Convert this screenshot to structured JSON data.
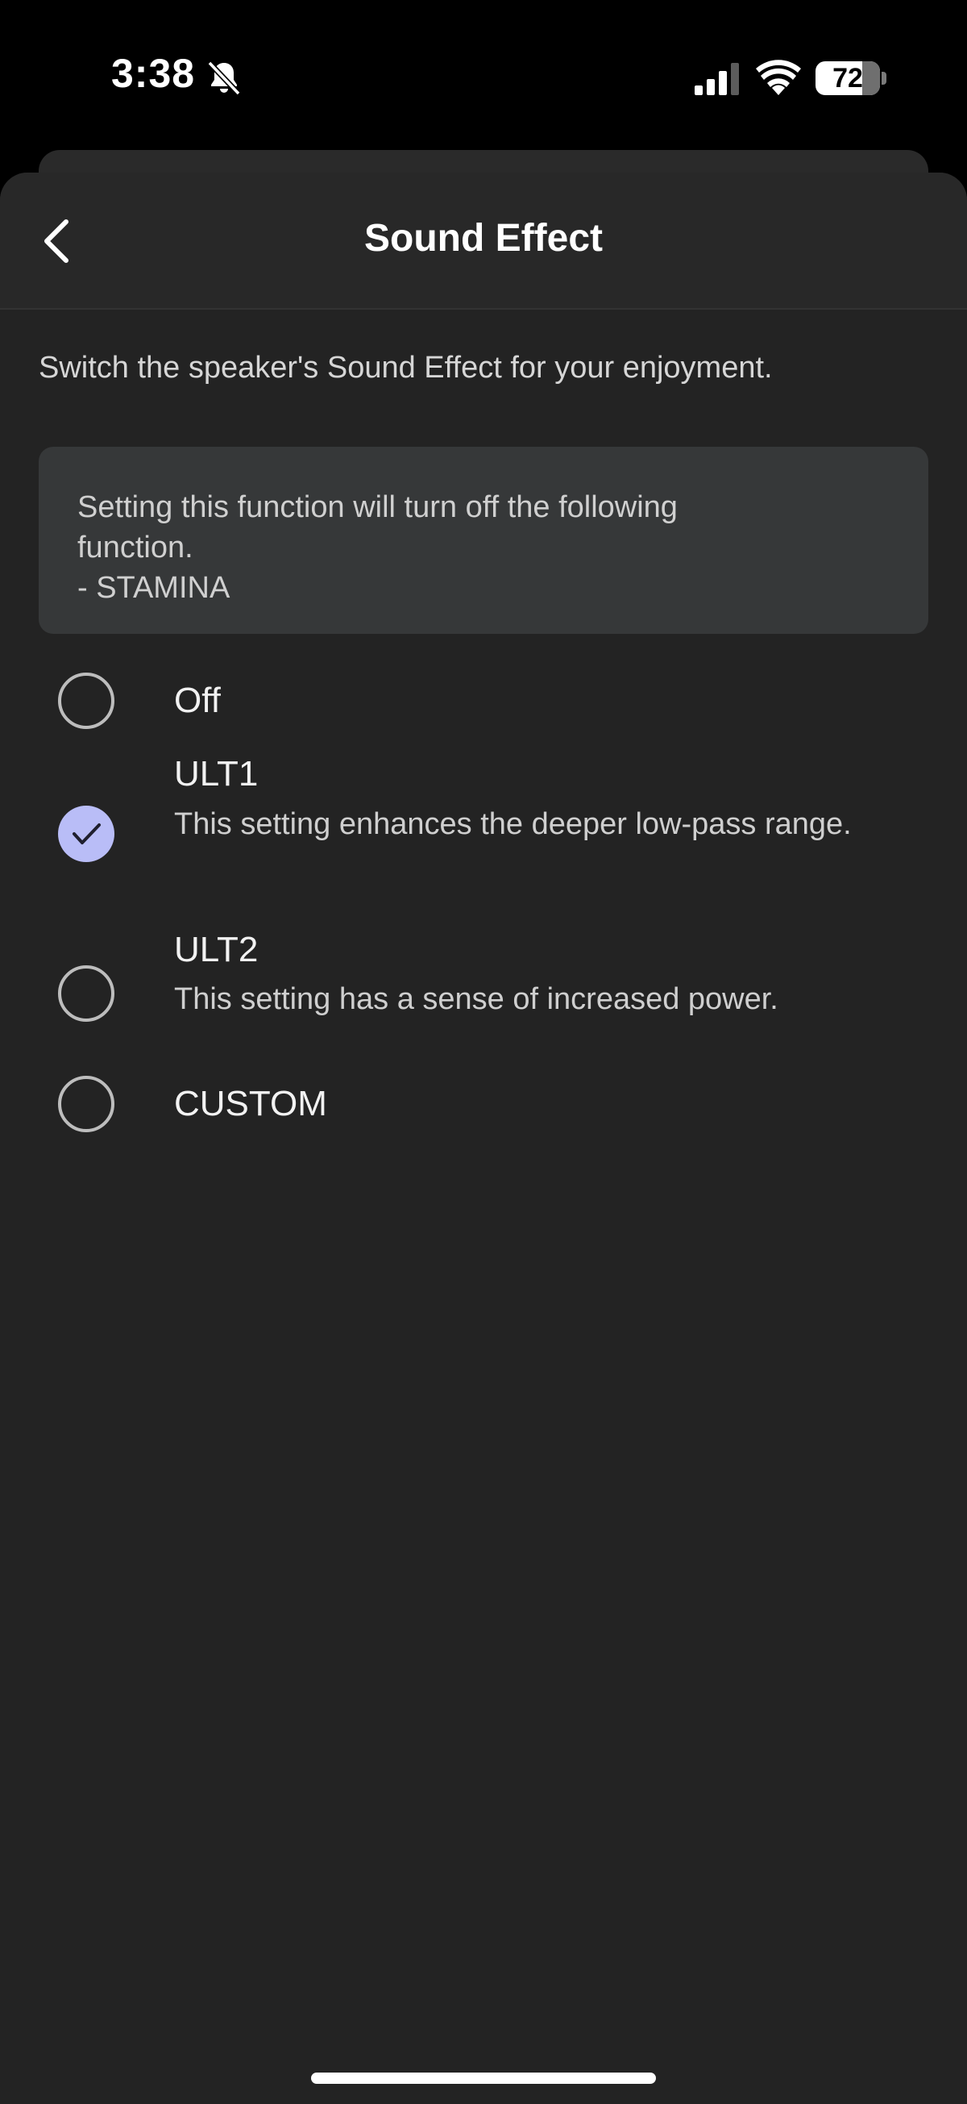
{
  "status_bar": {
    "time": "3:38",
    "battery_level": "72",
    "battery_fraction": 0.72,
    "icons": [
      "bell-slash-icon",
      "cellular-signal-icon",
      "wifi-icon",
      "battery-icon"
    ]
  },
  "header": {
    "title": "Sound Effect",
    "back_icon": "chevron-left-icon"
  },
  "main": {
    "description": "Switch the speaker's Sound Effect for your enjoyment.",
    "notice": {
      "line1": "Setting this function will turn off the following",
      "line2": "function.",
      "line3": "- STAMINA"
    },
    "options": [
      {
        "label": "Off",
        "description": "",
        "selected": false
      },
      {
        "label": "ULT1",
        "description": "This setting enhances the deeper low-pass range.",
        "selected": true
      },
      {
        "label": "ULT2",
        "description": "This setting has a sense of increased power.",
        "selected": false
      },
      {
        "label": "CUSTOM",
        "description": "",
        "selected": false
      }
    ]
  },
  "colors": {
    "background": "#232323",
    "nav_bar": "#282828",
    "notice_bg": "#363839",
    "radio_selected": "#b9bdf7",
    "radio_border": "#bdbdbd"
  }
}
